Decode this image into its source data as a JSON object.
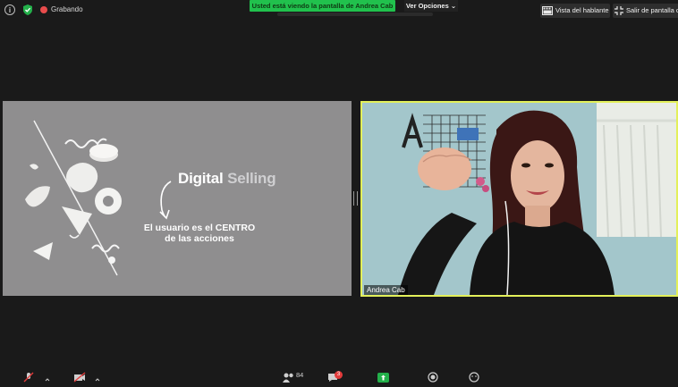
{
  "topbar": {
    "recording_label": "Grabando",
    "share_banner": "Usted está viendo la pantalla de Andrea Cab",
    "view_options_label": "Ver Opciones",
    "speaker_view_label": "Vista del hablante",
    "exit_fullscreen_label": "Salir de pantalla co"
  },
  "slide": {
    "title_word1": "Digital",
    "title_word2": "Selling",
    "subtitle_line1": "El usuario es el CENTRO",
    "subtitle_line2": "de las acciones"
  },
  "video": {
    "participant_name": "Andrea Cab"
  },
  "toolbar": {
    "participants_count": "84",
    "chat_badge": "3"
  },
  "colors": {
    "share_banner": "#21c14d",
    "active_speaker_border": "#e3f05a",
    "recording_dot": "#e84c4c",
    "slide_background": "#8f8e8f"
  }
}
